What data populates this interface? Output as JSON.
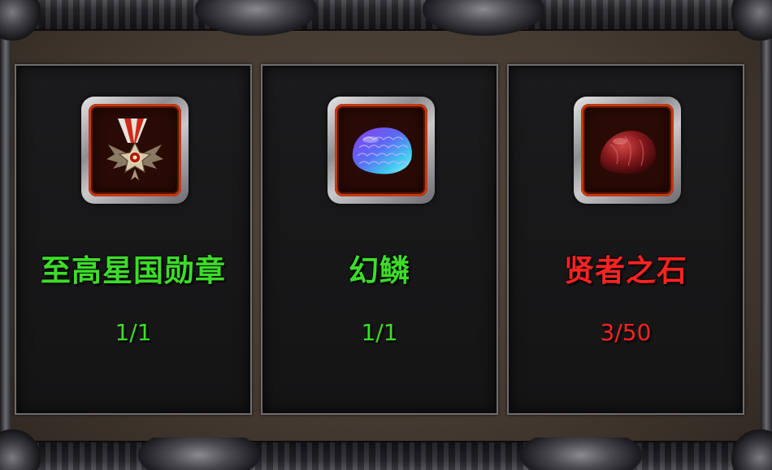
{
  "items": [
    {
      "name": "至高星国勋章",
      "count": "1/1",
      "icon": "medal-icon",
      "status_color": "#3ddc2a"
    },
    {
      "name": "幻鳞",
      "count": "1/1",
      "icon": "scale-icon",
      "status_color": "#3ddc2a"
    },
    {
      "name": "贤者之石",
      "count": "3/50",
      "icon": "stone-icon",
      "status_color": "#ff2323"
    }
  ],
  "colors": {
    "satisfied": "#3ddc2a",
    "insufficient": "#ff2323",
    "icon_slot_border": "#c23a12"
  }
}
